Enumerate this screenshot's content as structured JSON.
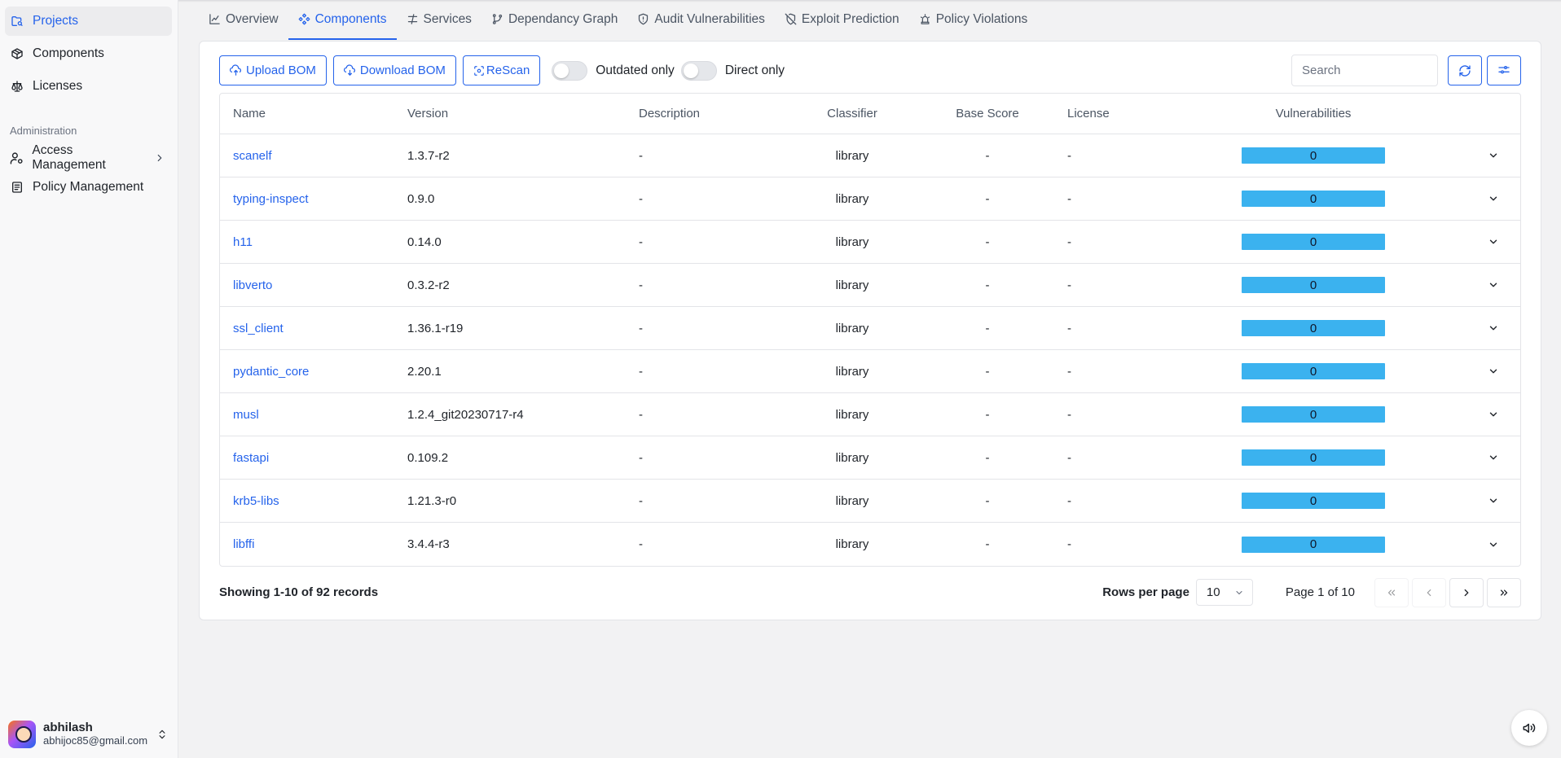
{
  "sidebar": {
    "items": [
      {
        "label": "Projects",
        "icon": "folder-search-icon",
        "active": true
      },
      {
        "label": "Components",
        "icon": "package-icon"
      },
      {
        "label": "Licenses",
        "icon": "scale-icon"
      }
    ],
    "section_label": "Administration",
    "admin_items": [
      {
        "label": "Access Management",
        "icon": "user-cog-icon",
        "has_chevron": true
      },
      {
        "label": "Policy Management",
        "icon": "clipboard-list-icon"
      }
    ],
    "user": {
      "name": "abhilash",
      "email": "abhijoc85@gmail.com"
    }
  },
  "tabs": [
    {
      "label": "Overview",
      "icon": "chart-line-icon"
    },
    {
      "label": "Components",
      "icon": "components-icon",
      "active": true
    },
    {
      "label": "Services",
      "icon": "waypoints-icon"
    },
    {
      "label": "Dependancy Graph",
      "icon": "git-graph-icon"
    },
    {
      "label": "Audit Vulnerabilities",
      "icon": "shield-icon"
    },
    {
      "label": "Exploit Prediction",
      "icon": "shield-off-icon"
    },
    {
      "label": "Policy Violations",
      "icon": "siren-icon"
    }
  ],
  "toolbar": {
    "upload_label": "Upload BOM",
    "download_label": "Download BOM",
    "rescan_label": "ReScan",
    "outdated_label": "Outdated only",
    "direct_label": "Direct only",
    "search_placeholder": "Search"
  },
  "table": {
    "headers": {
      "name": "Name",
      "version": "Version",
      "description": "Description",
      "classifier": "Classifier",
      "base_score": "Base Score",
      "license": "License",
      "vulnerabilities": "Vulnerabilities"
    },
    "rows": [
      {
        "name": "scanelf",
        "version": "1.3.7-r2",
        "description": "-",
        "classifier": "library",
        "base_score": "-",
        "license": "-",
        "vulnerabilities": "0"
      },
      {
        "name": "typing-inspect",
        "version": "0.9.0",
        "description": "-",
        "classifier": "library",
        "base_score": "-",
        "license": "-",
        "vulnerabilities": "0"
      },
      {
        "name": "h11",
        "version": "0.14.0",
        "description": "-",
        "classifier": "library",
        "base_score": "-",
        "license": "-",
        "vulnerabilities": "0"
      },
      {
        "name": "libverto",
        "version": "0.3.2-r2",
        "description": "-",
        "classifier": "library",
        "base_score": "-",
        "license": "-",
        "vulnerabilities": "0"
      },
      {
        "name": "ssl_client",
        "version": "1.36.1-r19",
        "description": "-",
        "classifier": "library",
        "base_score": "-",
        "license": "-",
        "vulnerabilities": "0"
      },
      {
        "name": "pydantic_core",
        "version": "2.20.1",
        "description": "-",
        "classifier": "library",
        "base_score": "-",
        "license": "-",
        "vulnerabilities": "0"
      },
      {
        "name": "musl",
        "version": "1.2.4_git20230717-r4",
        "description": "-",
        "classifier": "library",
        "base_score": "-",
        "license": "-",
        "vulnerabilities": "0"
      },
      {
        "name": "fastapi",
        "version": "0.109.2",
        "description": "-",
        "classifier": "library",
        "base_score": "-",
        "license": "-",
        "vulnerabilities": "0"
      },
      {
        "name": "krb5-libs",
        "version": "1.21.3-r0",
        "description": "-",
        "classifier": "library",
        "base_score": "-",
        "license": "-",
        "vulnerabilities": "0"
      },
      {
        "name": "libffi",
        "version": "3.4.4-r3",
        "description": "-",
        "classifier": "library",
        "base_score": "-",
        "license": "-",
        "vulnerabilities": "0"
      }
    ]
  },
  "footer": {
    "records_text": "Showing 1-10 of 92 records",
    "rows_per_page_label": "Rows per page",
    "rows_per_page_value": "10",
    "page_info": "Page 1 of 10"
  },
  "colors": {
    "accent": "#2563eb",
    "vuln_bar": "#3bb2ef",
    "background": "#f2f2f3"
  }
}
